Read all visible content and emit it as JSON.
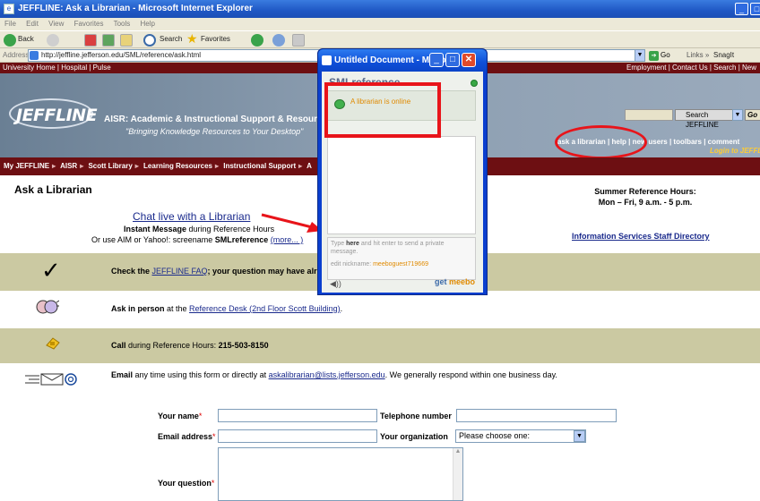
{
  "ie": {
    "title": "JEFFLINE: Ask a Librarian - Microsoft Internet Explorer",
    "menu": [
      "File",
      "Edit",
      "View",
      "Favorites",
      "Tools",
      "Help"
    ],
    "toolbar": {
      "back": "Back",
      "search": "Search",
      "favorites": "Favorites"
    },
    "address_label": "Address",
    "address_url": "http://jeffline.jefferson.edu/SML/reference/ask.html",
    "go": "Go",
    "links": "Links",
    "snagit": "SnagIt"
  },
  "site": {
    "topbar_left": "University Home | Hospital | Pulse",
    "topbar_right": "Employment | Contact Us | Search | New",
    "logo": "JEFFLINE",
    "aisr_title": "AISR: Academic & Instructional Support & Resources",
    "aisr_tagline": "\"Bringing Knowledge Resources to Your Desktop\"",
    "search_button": "Search JEFFLINE",
    "go_button": "Go",
    "header_links": "ask a librarian | help | new users | toolbars | comment",
    "login_link": "Login to JEFFLINE",
    "breadcrumb": [
      "My JEFFLINE",
      "AISR",
      "Scott Library",
      "Learning Resources",
      "Instructional Support",
      "A"
    ]
  },
  "content": {
    "heading": "Ask a Librarian",
    "chat_link": "Chat live with a Librarian",
    "instant_message_bold": "Instant Message",
    "instant_message_rest": " during Reference Hours",
    "aim_prefix": "Or use AIM or Yahoo!: screename ",
    "aim_screenname": "SMLreference",
    "aim_more": "(more... )",
    "summer_heading": "Summer Reference Hours:",
    "summer_hours": "Mon – Fri, 9 a.m. - 5 p.m.",
    "staff_directory": "Information Services Staff Directory",
    "faq_prefix": "Check the ",
    "faq_link": "JEFFLINE FAQ",
    "faq_suffix": "; your question may have alread",
    "person_bold": "Ask in person",
    "person_mid": " at the ",
    "person_link": "Reference Desk (2nd Floor Scott Building)",
    "person_end": ".",
    "phone_bold": "Call",
    "phone_text": " during Reference Hours: ",
    "phone_number": "215-503-8150",
    "email_bold": "Email",
    "email_text": " any time using this form or directly at ",
    "email_link": "askalibrarian@lists.jefferson.edu",
    "email_end": ". We generally respond within one business day."
  },
  "form": {
    "name_label": "Your name",
    "email_label": "Email address",
    "question_label": "Your question",
    "phone_label": "Telephone number",
    "org_label": "Your organization",
    "org_selected": "Please choose one:",
    "required_mark": "*"
  },
  "popup": {
    "title": "Untitled Document - Micro...",
    "sml_title": "SMLreference",
    "online_text": "A librarian is online",
    "placeholder_pre": "Type ",
    "placeholder_bold": "here",
    "placeholder_post": " and hit enter to send a private message.",
    "nickname_label": "edit nickname: ",
    "nickname": "meeboguest719669",
    "meebo_pre": "get ",
    "meebo_brand": "meebo"
  },
  "colors": {
    "nav_maroon": "#6d0f12",
    "row_khaki": "#cbc9a2",
    "highlight_red": "#e8141a",
    "xp_blue": "#0a3fcf"
  }
}
